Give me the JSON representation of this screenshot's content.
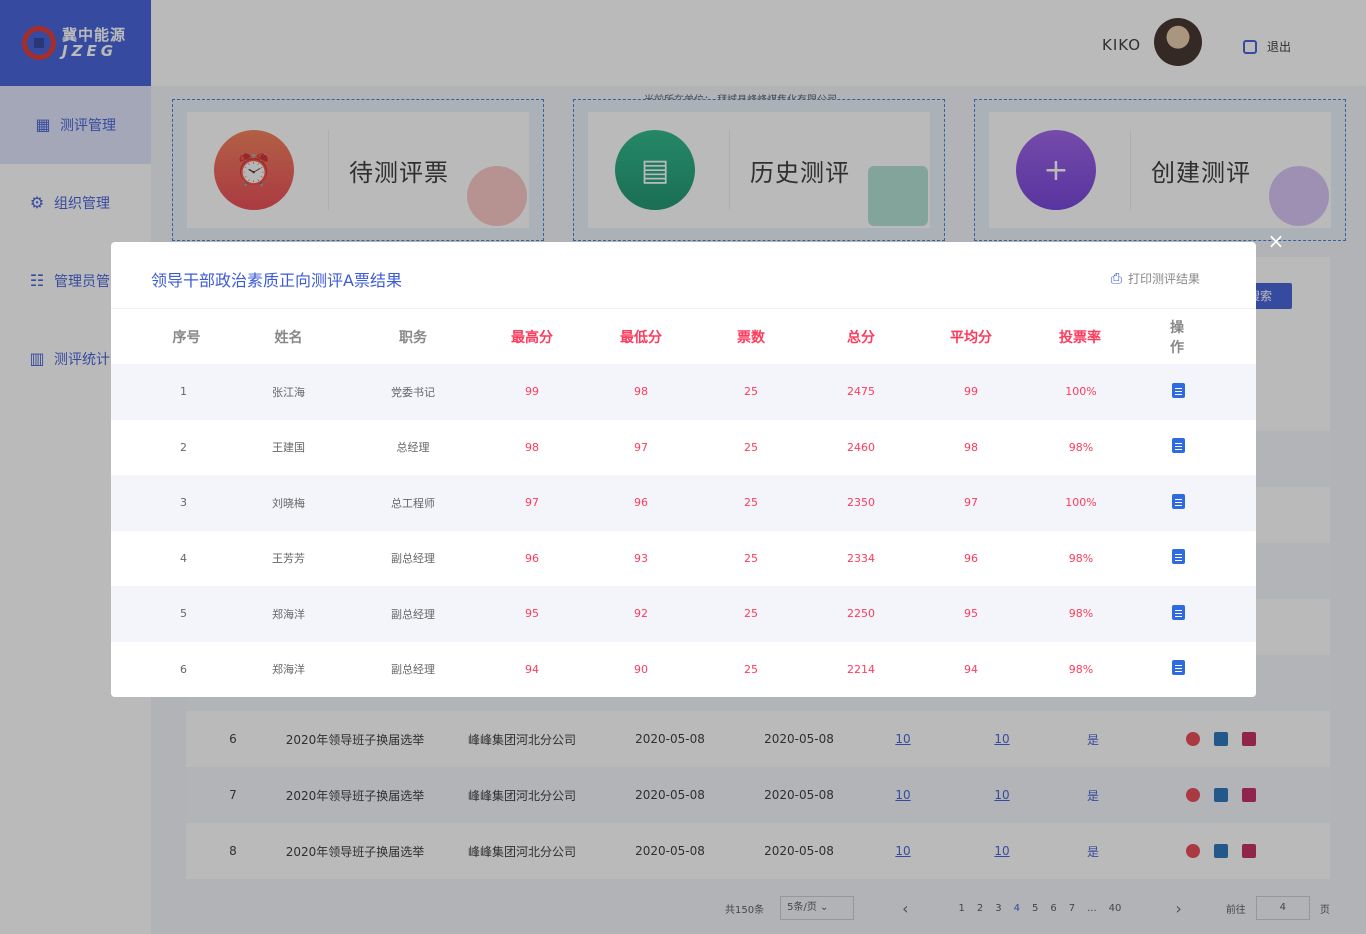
{
  "app": {
    "logo_cn": "冀中能源",
    "logo_en": "JZEG"
  },
  "sidebar": {
    "items": [
      {
        "label": "测评管理",
        "icon": "grid-icon"
      },
      {
        "label": "组织管理",
        "icon": "gear-icon"
      },
      {
        "label": "管理员管",
        "icon": "users-icon"
      },
      {
        "label": "测评统计",
        "icon": "bar-chart-icon"
      }
    ]
  },
  "header": {
    "username": "KIKO",
    "logout": "退出"
  },
  "unit": "当前所在单位： 拜城县峰峰煤焦化有限公司",
  "cards": [
    {
      "label": "待测评票",
      "icon": "alarm-clock-icon",
      "color": "#f0584e"
    },
    {
      "label": "历史测评",
      "icon": "document-clock-icon",
      "color": "#1ba37a"
    },
    {
      "label": "创建测评",
      "icon": "plus-circle-icon",
      "color": "#8a4fe0"
    }
  ],
  "search_button": "搜索",
  "bg_table": {
    "rows": [
      {
        "no": "6",
        "name": "2020年领导班子换届选举",
        "org": "峰峰集团河北分公司",
        "start": "2020-05-08",
        "end": "2020-05-08",
        "a": "10",
        "b": "10",
        "flag": "是"
      },
      {
        "no": "7",
        "name": "2020年领导班子换届选举",
        "org": "峰峰集团河北分公司",
        "start": "2020-05-08",
        "end": "2020-05-08",
        "a": "10",
        "b": "10",
        "flag": "是"
      },
      {
        "no": "8",
        "name": "2020年领导班子换届选举",
        "org": "峰峰集团河北分公司",
        "start": "2020-05-08",
        "end": "2020-05-08",
        "a": "10",
        "b": "10",
        "flag": "是"
      }
    ]
  },
  "pager": {
    "total": "共150条",
    "page_size": "5条/页",
    "pages": [
      "1",
      "2",
      "3",
      "4",
      "5",
      "6",
      "7",
      "...",
      "40"
    ],
    "current": "4",
    "goto": "前往",
    "goto_value": "4",
    "page_unit": "页"
  },
  "modal": {
    "title": "领导干部政治素质正向测评A票结果",
    "print": "打印测评结果",
    "close": "×",
    "columns": [
      "序号",
      "姓名",
      "职务",
      "最高分",
      "最低分",
      "票数",
      "总分",
      "平均分",
      "投票率",
      "操作"
    ],
    "rows": [
      {
        "no": "1",
        "name": "张江海",
        "title": "党委书记",
        "max": "99",
        "min": "98",
        "votes": "25",
        "total": "2475",
        "avg": "99",
        "rate": "100%"
      },
      {
        "no": "2",
        "name": "王建国",
        "title": "总经理",
        "max": "98",
        "min": "97",
        "votes": "25",
        "total": "2460",
        "avg": "98",
        "rate": "98%"
      },
      {
        "no": "3",
        "name": "刘晓梅",
        "title": "总工程师",
        "max": "97",
        "min": "96",
        "votes": "25",
        "total": "2350",
        "avg": "97",
        "rate": "100%"
      },
      {
        "no": "4",
        "name": "王芳芳",
        "title": "副总经理",
        "max": "96",
        "min": "93",
        "votes": "25",
        "total": "2334",
        "avg": "96",
        "rate": "98%"
      },
      {
        "no": "5",
        "name": "郑海洋",
        "title": "副总经理",
        "max": "95",
        "min": "92",
        "votes": "25",
        "total": "2250",
        "avg": "95",
        "rate": "98%"
      },
      {
        "no": "6",
        "name": "郑海洋",
        "title": "副总经理",
        "max": "94",
        "min": "90",
        "votes": "25",
        "total": "2214",
        "avg": "94",
        "rate": "98%"
      }
    ]
  },
  "colors": {
    "accent": "#3d5bd8",
    "score": "#ff3b5c"
  }
}
